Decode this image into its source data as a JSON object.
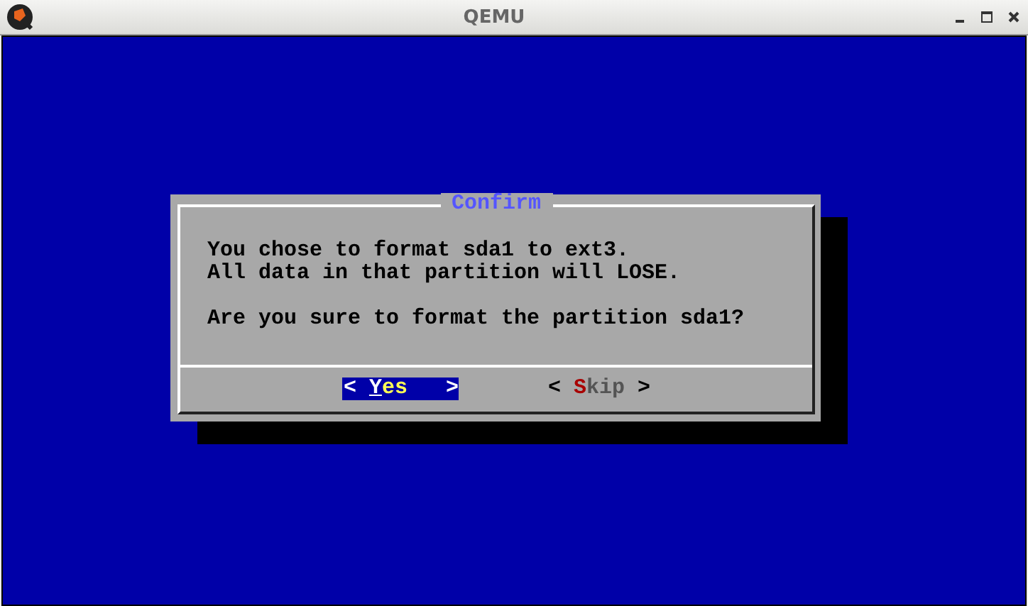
{
  "window": {
    "title": "QEMU"
  },
  "dialog": {
    "title": "Confirm",
    "paragraphs": [
      [
        "You chose to format sda1 to ext3.",
        "All data in that partition will LOSE."
      ],
      [
        "Are you sure to format the partition sda1?"
      ]
    ],
    "buttons": [
      {
        "open": "<",
        "hotkey": "Y",
        "rest": "es",
        "close": ">",
        "selected": true
      },
      {
        "open": "<",
        "hotkey": "S",
        "rest": "kip",
        "close": ">",
        "selected": false
      }
    ]
  }
}
